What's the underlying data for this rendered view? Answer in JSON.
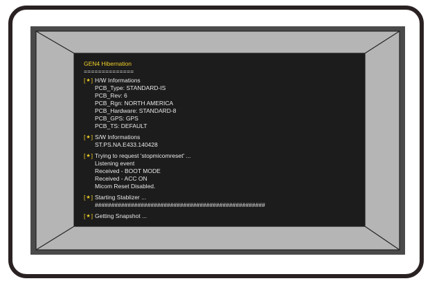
{
  "console": {
    "title": "GEN4 Hibernation",
    "underline": "==============",
    "star_glyph": "★",
    "bracket_open": "[",
    "bracket_close": "]",
    "sections": [
      {
        "heading": "H/W Informations",
        "lines": [
          "PCB_Type: STANDARD-IS",
          "PCB_Rev: 6",
          "PCB_Rgn: NORTH AMERICA",
          "PCB_Hardware: STANDARD-8",
          "PCB_GPS: GPS",
          "PCB_TS: DEFAULT"
        ]
      },
      {
        "heading": "S/W Informations",
        "lines": [
          "ST.PS.NA.E433.140428"
        ]
      },
      {
        "heading": "Trying to request 'stopmicomreset' ...",
        "lines": [
          "Listening event",
          "Received - BOOT MODE",
          "Received - ACC ON",
          "Micom Reset Disabled."
        ]
      },
      {
        "heading": "Starting Stablizer ...",
        "lines": [
          "####################################################"
        ]
      },
      {
        "heading": "Getting Snapshot ...",
        "lines": []
      }
    ]
  },
  "colors": {
    "accent_yellow": "#f2d027",
    "terminal_bg": "#1c1c1c",
    "terminal_text": "#e9e9e9",
    "bezel_dark": "#4a4a4a",
    "bezel_light": "#b3b3b3"
  }
}
